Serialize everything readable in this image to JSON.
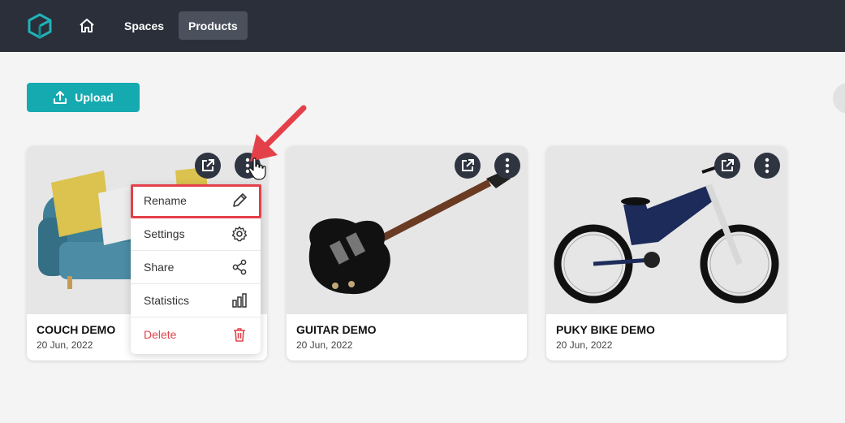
{
  "nav": {
    "home_icon": "home-icon",
    "tabs": [
      {
        "label": "Spaces",
        "active": false
      },
      {
        "label": "Products",
        "active": true
      }
    ]
  },
  "toolbar": {
    "upload_label": "Upload"
  },
  "cards": [
    {
      "title": "COUCH DEMO",
      "date": "20 Jun, 2022"
    },
    {
      "title": "GUITAR DEMO",
      "date": "20 Jun, 2022"
    },
    {
      "title": "PUKY BIKE DEMO",
      "date": "20 Jun, 2022"
    }
  ],
  "context_menu": {
    "items": [
      {
        "label": "Rename",
        "icon": "pencil-icon"
      },
      {
        "label": "Settings",
        "icon": "gear-icon"
      },
      {
        "label": "Share",
        "icon": "share-icon"
      },
      {
        "label": "Statistics",
        "icon": "bar-chart-icon"
      },
      {
        "label": "Delete",
        "icon": "trash-icon"
      }
    ]
  },
  "colors": {
    "topbar": "#2a2f3a",
    "accent": "#15aab0",
    "danger": "#e0434b",
    "annotation": "#e4404a"
  }
}
